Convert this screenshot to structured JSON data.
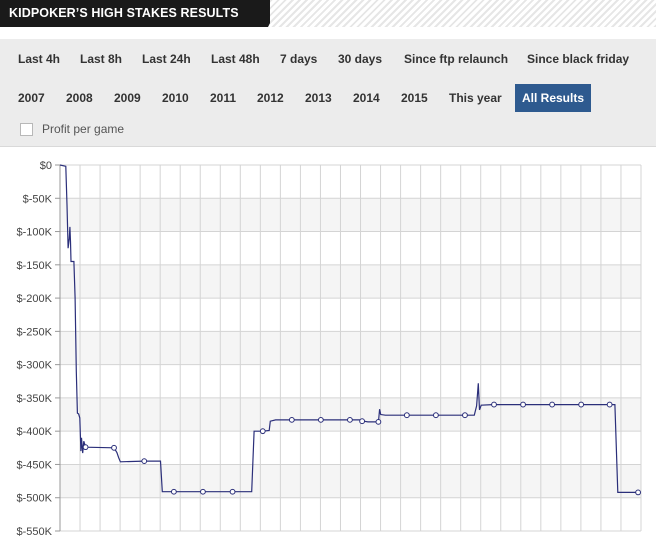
{
  "header": {
    "title": "KIDPOKER’S HIGH STAKES RESULTS"
  },
  "filters": {
    "row1": [
      "Last 4h",
      "Last 8h",
      "Last 24h",
      "Last 48h",
      "7 days",
      "30 days",
      "Since ftp relaunch",
      "Since black friday"
    ],
    "row2": [
      "2007",
      "2008",
      "2009",
      "2010",
      "2011",
      "2012",
      "2013",
      "2014",
      "2015",
      "This year",
      "All Results"
    ],
    "active": "All Results",
    "checkbox_label": "Profit per game",
    "checkbox_checked": false
  },
  "colors": {
    "line": "#2b2f7a",
    "active_button": "#2e5a8f",
    "grid": "#d4d4d4",
    "band": "#f5f5f5"
  },
  "chart_data": {
    "type": "line",
    "title": "",
    "xlabel": "",
    "ylabel": "",
    "ylim": [
      -550000,
      0
    ],
    "yticks": [
      0,
      -50000,
      -100000,
      -150000,
      -200000,
      -250000,
      -300000,
      -350000,
      -400000,
      -450000,
      -500000,
      -550000
    ],
    "ytick_labels": [
      "$0",
      "$-50K",
      "$-100K",
      "$-150K",
      "$-200K",
      "$-250K",
      "$-300K",
      "$-350K",
      "$-400K",
      "$-450K",
      "$-500K",
      "$-550K"
    ],
    "grid": true,
    "series": [
      {
        "markers": [
          {
            "x": 0.044,
            "y": -424000
          },
          {
            "x": 0.093,
            "y": -425000
          },
          {
            "x": 0.145,
            "y": -445000
          },
          {
            "x": 0.196,
            "y": -491000
          },
          {
            "x": 0.246,
            "y": -491000
          },
          {
            "x": 0.297,
            "y": -491000
          },
          {
            "x": 0.349,
            "y": -400000
          },
          {
            "x": 0.399,
            "y": -383000
          },
          {
            "x": 0.449,
            "y": -383000
          },
          {
            "x": 0.499,
            "y": -383000
          },
          {
            "x": 0.52,
            "y": -385000
          },
          {
            "x": 0.548,
            "y": -386000
          },
          {
            "x": 0.597,
            "y": -376000
          },
          {
            "x": 0.647,
            "y": -376000
          },
          {
            "x": 0.697,
            "y": -376000
          },
          {
            "x": 0.747,
            "y": -360000
          },
          {
            "x": 0.797,
            "y": -360000
          },
          {
            "x": 0.847,
            "y": -360000
          },
          {
            "x": 0.897,
            "y": -360000
          },
          {
            "x": 0.946,
            "y": -360000
          },
          {
            "x": 0.995,
            "y": -492000
          }
        ],
        "path": [
          [
            0.0,
            0
          ],
          [
            0.01,
            -2000
          ],
          [
            0.012,
            -60000
          ],
          [
            0.014,
            -125000
          ],
          [
            0.016,
            -110000
          ],
          [
            0.017,
            -93000
          ],
          [
            0.018,
            -115000
          ],
          [
            0.019,
            -145000
          ],
          [
            0.024,
            -145000
          ],
          [
            0.026,
            -200000
          ],
          [
            0.028,
            -310000
          ],
          [
            0.03,
            -373000
          ],
          [
            0.032,
            -374000
          ],
          [
            0.034,
            -380000
          ],
          [
            0.036,
            -430000
          ],
          [
            0.037,
            -410000
          ],
          [
            0.039,
            -433000
          ],
          [
            0.041,
            -415000
          ],
          [
            0.044,
            -424000
          ],
          [
            0.093,
            -425000
          ],
          [
            0.098,
            -432000
          ],
          [
            0.101,
            -440000
          ],
          [
            0.104,
            -446000
          ],
          [
            0.145,
            -445000
          ],
          [
            0.173,
            -445000
          ],
          [
            0.176,
            -491000
          ],
          [
            0.33,
            -491000
          ],
          [
            0.334,
            -400000
          ],
          [
            0.349,
            -400000
          ],
          [
            0.36,
            -399000
          ],
          [
            0.362,
            -385000
          ],
          [
            0.371,
            -383000
          ],
          [
            0.52,
            -383000
          ],
          [
            0.523,
            -385000
          ],
          [
            0.53,
            -386000
          ],
          [
            0.545,
            -386000
          ],
          [
            0.548,
            -387000
          ],
          [
            0.55,
            -367000
          ],
          [
            0.552,
            -375000
          ],
          [
            0.56,
            -376000
          ],
          [
            0.713,
            -376000
          ],
          [
            0.717,
            -362000
          ],
          [
            0.72,
            -328000
          ],
          [
            0.722,
            -368000
          ],
          [
            0.725,
            -361000
          ],
          [
            0.745,
            -360000
          ],
          [
            0.955,
            -360000
          ],
          [
            0.96,
            -492000
          ],
          [
            0.995,
            -492000
          ]
        ]
      }
    ]
  }
}
